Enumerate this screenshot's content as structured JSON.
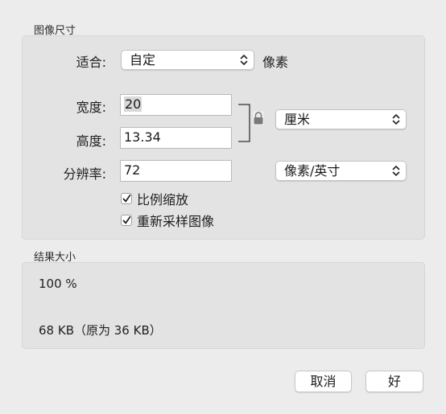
{
  "image_size": {
    "title": "图像尺寸",
    "fit": {
      "label": "适合:",
      "value": "自定",
      "unit": "像素"
    },
    "width": {
      "label": "宽度:",
      "value": "20"
    },
    "height": {
      "label": "高度:",
      "value": "13.34"
    },
    "dimension_unit": "厘米",
    "resolution": {
      "label": "分辨率:",
      "value": "72",
      "unit": "像素/英寸"
    },
    "scale_proportionally": {
      "label": "比例缩放",
      "checked": true
    },
    "resample_image": {
      "label": "重新采样图像",
      "checked": true
    }
  },
  "result_size": {
    "title": "结果大小",
    "percent": "100 %",
    "file_size": "68 KB（原为 36 KB）"
  },
  "buttons": {
    "cancel": "取消",
    "ok": "好"
  }
}
